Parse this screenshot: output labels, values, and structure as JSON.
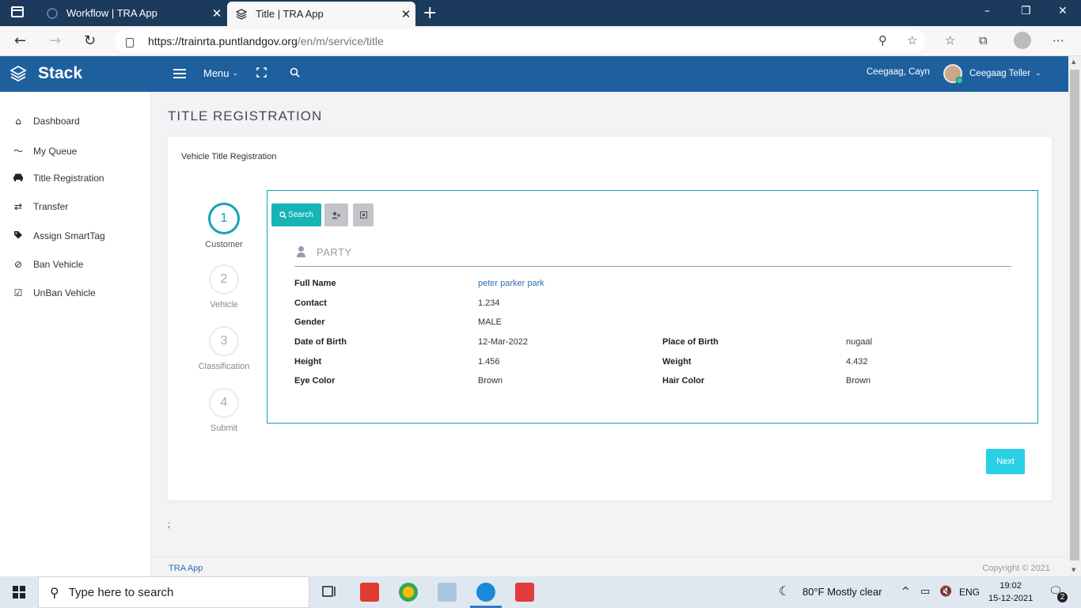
{
  "browser": {
    "tabs": [
      {
        "label": "Workflow | TRA App",
        "active": false
      },
      {
        "label": "Title | TRA App",
        "active": true
      }
    ],
    "url_main": "https://trainrta.puntlandgov.org",
    "url_path": "/en/m/service/title"
  },
  "header": {
    "brand": "Stack",
    "menu_label": "Menu",
    "user_location": "Ceegaag, Cayn",
    "user_name": "Ceegaag Teller"
  },
  "sidebar": {
    "items": [
      {
        "label": "Dashboard",
        "icon": "home-icon"
      },
      {
        "label": "My Queue",
        "icon": "trend-icon"
      },
      {
        "label": "Title Registration",
        "icon": "car-icon"
      },
      {
        "label": "Transfer",
        "icon": "exchange-icon"
      },
      {
        "label": "Assign SmartTag",
        "icon": "tags-icon"
      },
      {
        "label": "Ban Vehicle",
        "icon": "ban-icon"
      },
      {
        "label": "UnBan Vehicle",
        "icon": "check-square-icon"
      }
    ]
  },
  "page": {
    "title": "TITLE REGISTRATION",
    "card_title": "Vehicle Title Registration"
  },
  "wizard": {
    "steps": [
      {
        "num": "1",
        "label": "Customer",
        "active": true
      },
      {
        "num": "2",
        "label": "Vehicle",
        "active": false
      },
      {
        "num": "3",
        "label": "Classification",
        "active": false
      },
      {
        "num": "4",
        "label": "Submit",
        "active": false
      }
    ],
    "search_label": "Search",
    "next_label": "Next"
  },
  "party": {
    "heading": "PARTY",
    "fields": {
      "full_name_label": "Full Name",
      "full_name": "peter parker park",
      "contact_label": "Contact",
      "contact": "1.234",
      "gender_label": "Gender",
      "gender": "MALE",
      "dob_label": "Date of Birth",
      "dob": "12-Mar-2022",
      "pob_label": "Place of Birth",
      "pob": "nugaal",
      "height_label": "Height",
      "height": "1.456",
      "weight_label": "Weight",
      "weight": "4.432",
      "eye_label": "Eye Color",
      "eye": "Brown",
      "hair_label": "Hair Color",
      "hair": "Brown"
    }
  },
  "misc": {
    "semicolon": ";"
  },
  "footer": {
    "left": "TRA App",
    "right": "Copyright © 2021"
  },
  "taskbar": {
    "search_placeholder": "Type here to search",
    "weather": "80°F  Mostly clear",
    "lang": "ENG",
    "time": "19:02",
    "date": "15-12-2021",
    "notifications": "2"
  },
  "colors": {
    "header_bg": "#1e5f9e",
    "accent_teal": "#17a2b8",
    "next_btn": "#2ad0e6",
    "tab_strip": "#1b3a5c"
  }
}
